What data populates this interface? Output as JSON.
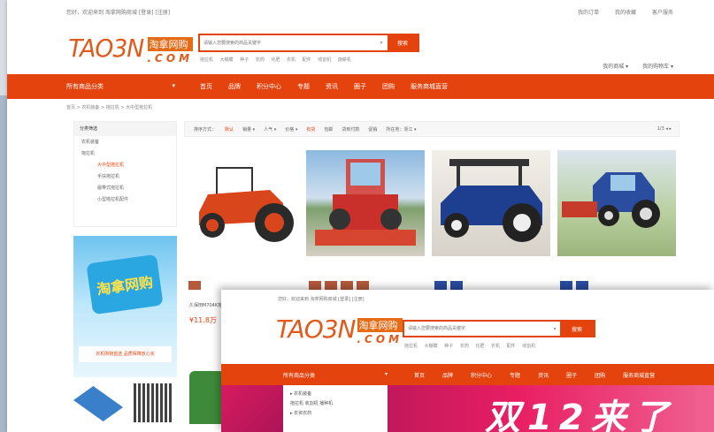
{
  "topbar": {
    "left": "您好，欢迎来到 淘拿网购商城 [登录] [注册]",
    "links": [
      "我的订单",
      "我的收藏",
      "客户服务"
    ]
  },
  "logo": {
    "word": "TAO3N",
    "cn": "淘拿网购",
    "com": ".COM"
  },
  "search": {
    "placeholder": "请输入您要搜索的商品关键字",
    "button": "搜索",
    "dropdown": "▾"
  },
  "hot": [
    "拖拉机",
    "大棚膜",
    "种子",
    "农药",
    "化肥",
    "农机",
    "配件",
    "收割机",
    "旋耕机"
  ],
  "user_links": [
    "我的商城 ▾",
    "我的购物车 ▾"
  ],
  "nav": {
    "category": "所有商品分类",
    "category_arrow": "▾",
    "items": [
      "首页",
      "品牌",
      "积分中心",
      "专题",
      "资讯",
      "圈子",
      "团购",
      "服务商城直营"
    ]
  },
  "breadcrumb": "首页 > 农机装备 > 拖拉机 > 大中型拖拉机",
  "sidebar": {
    "head": "分类筛选",
    "rows": [
      "农机装备",
      "拖拉机"
    ],
    "subs": [
      "大中型拖拉机",
      "手扶拖拉机",
      "履带式拖拉机",
      "小型拖拉机配件"
    ]
  },
  "banner": {
    "headline": "淘拿网购",
    "ribbon": "农机购物首选 品质保障放心买"
  },
  "filterbar": {
    "label": "排序方式：",
    "sorts": [
      "默认",
      "销量 ▾",
      "人气 ▾",
      "价格 ▾"
    ],
    "options": [
      "有货",
      "包邮",
      "货到付款",
      "促销"
    ],
    "location": "所在地：浙江 ▾",
    "pager": "1/3 ◂ ▸"
  },
  "product": {
    "title": "久保田M704K拖拉机",
    "price": "¥11.8万"
  },
  "front": {
    "topbar": "您好，欢迎来到 淘拿网购商城 [登录] [注册]",
    "search": {
      "placeholder": "请输入您要搜索的商品关键字",
      "button": "搜索",
      "dropdown": "▾"
    },
    "hot": [
      "拖拉机",
      "大棚膜",
      "种子",
      "农药",
      "化肥",
      "农机",
      "配件",
      "收割机"
    ],
    "nav": {
      "category": "所有商品分类",
      "category_arrow": "▾",
      "items": [
        "首页",
        "品牌",
        "积分中心",
        "专题",
        "资讯",
        "圈子",
        "团购",
        "服务商城直营"
      ]
    },
    "menu": [
      "▸ 农机装备",
      "拖拉机 收割机 播种机",
      "▸ 农资农药"
    ],
    "promo": "双12来了"
  }
}
